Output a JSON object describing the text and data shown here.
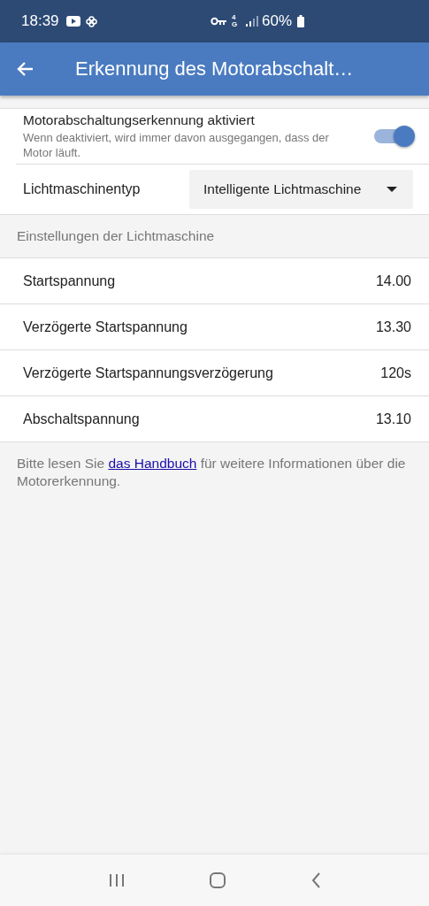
{
  "status_bar": {
    "time": "18:39",
    "network": "4G",
    "battery": "60%"
  },
  "app_bar": {
    "title": "Erkennung des Motorabschalt…"
  },
  "toggle": {
    "label": "Motorabschaltungserkennung aktiviert",
    "description": "Wenn deaktiviert, wird immer davon ausgegangen, dass der Motor läuft.",
    "on": true
  },
  "dropdown": {
    "label": "Lichtmaschinentyp",
    "value": "Intelligente Lichtmaschine"
  },
  "section": {
    "title": "Einstellungen der Lichtmaschine"
  },
  "settings": [
    {
      "label": "Startspannung",
      "value": "14.00"
    },
    {
      "label": "Verzögerte Startspannung",
      "value": "13.30"
    },
    {
      "label": "Verzögerte Startspannungsverzögerung",
      "value": "120s"
    },
    {
      "label": "Abschaltspannung",
      "value": "13.10"
    }
  ],
  "note": {
    "before": "Bitte lesen Sie",
    "link": "das Handbuch",
    "after": "für weitere Informationen über die Motorerkennung."
  }
}
